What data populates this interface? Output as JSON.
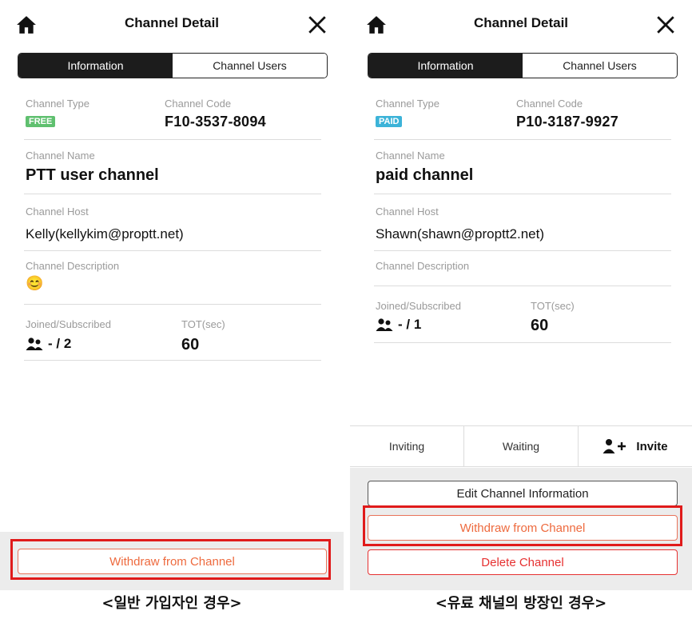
{
  "left": {
    "title": "Channel Detail",
    "tabs": [
      "Information",
      "Channel Users"
    ],
    "channel_type_label": "Channel Type",
    "channel_type_badge": "FREE",
    "channel_code_label": "Channel Code",
    "channel_code": "F10-3537-8094",
    "channel_name_label": "Channel Name",
    "channel_name": "PTT user channel",
    "channel_host_label": "Channel Host",
    "channel_host": "Kelly(kellykim@proptt.net)",
    "channel_description_label": "Channel Description",
    "channel_description": "😊",
    "joined_label": "Joined/Subscribed",
    "joined_value": "- / 2",
    "tot_label": "TOT(sec)",
    "tot_value": "60",
    "withdraw_button": "Withdraw from Channel",
    "caption": "<일반 가입자인 경우>"
  },
  "right": {
    "title": "Channel Detail",
    "tabs": [
      "Information",
      "Channel Users"
    ],
    "channel_type_label": "Channel Type",
    "channel_type_badge": "PAID",
    "channel_code_label": "Channel Code",
    "channel_code": "P10-3187-9927",
    "channel_name_label": "Channel Name",
    "channel_name": "paid channel",
    "channel_host_label": "Channel Host",
    "channel_host": "Shawn(shawn@proptt2.net)",
    "channel_description_label": "Channel Description",
    "joined_label": "Joined/Subscribed",
    "joined_value": "- / 1",
    "tot_label": "TOT(sec)",
    "tot_value": "60",
    "inviting_label": "Inviting",
    "waiting_label": "Waiting",
    "invite_label": "Invite",
    "edit_button": "Edit Channel Information",
    "withdraw_button": "Withdraw from Channel",
    "delete_button": "Delete Channel",
    "caption": "<유료 채널의 방장인 경우>"
  },
  "colors": {
    "free_badge": "#5fc06f",
    "paid_badge": "#3cb3d8",
    "highlight": "#e01b1b",
    "withdraw_text": "#ee6a3e",
    "delete_text": "#e63030"
  },
  "icons": [
    "home-icon",
    "close-icon",
    "people-icon",
    "add-user-icon"
  ]
}
